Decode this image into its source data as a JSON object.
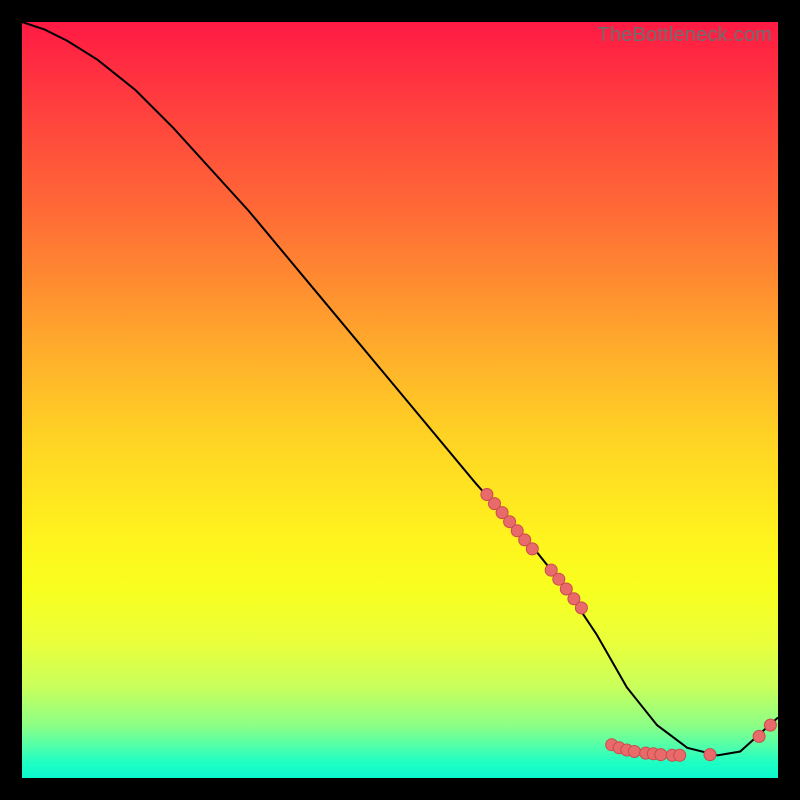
{
  "watermark": "TheBottleneck.com",
  "colors": {
    "curve": "#000000",
    "marker_fill": "#e86a6a",
    "marker_stroke": "#c94b4b"
  },
  "chart_data": {
    "type": "line",
    "title": "",
    "xlabel": "",
    "ylabel": "",
    "xlim": [
      0,
      100
    ],
    "ylim": [
      0,
      100
    ],
    "curve": {
      "x": [
        0,
        3,
        6,
        10,
        15,
        20,
        30,
        40,
        50,
        60,
        68,
        72,
        76,
        80,
        84,
        88,
        92,
        95,
        100
      ],
      "y": [
        100,
        99,
        97.5,
        95,
        91,
        86,
        75,
        63,
        51,
        39,
        30,
        25,
        19,
        12,
        7,
        4,
        3,
        3.5,
        8
      ]
    },
    "series": [
      {
        "name": "marker-cluster-upper",
        "x": [
          61.5,
          62.5,
          63.5,
          64.5,
          65.5,
          66.5,
          67.5,
          70.0,
          71.0,
          72.0,
          73.0,
          74.0
        ],
        "y": [
          37.5,
          36.3,
          35.1,
          33.9,
          32.7,
          31.5,
          30.3,
          27.5,
          26.3,
          25.0,
          23.7,
          22.5
        ]
      },
      {
        "name": "marker-cluster-lower",
        "x": [
          78.0,
          79.0,
          80.0,
          81.0,
          82.5,
          83.5,
          84.5,
          86.0,
          87.0,
          91.0,
          97.5,
          99.0
        ],
        "y": [
          4.4,
          4.0,
          3.7,
          3.5,
          3.3,
          3.2,
          3.1,
          3.0,
          3.0,
          3.1,
          5.5,
          7.0
        ]
      }
    ]
  }
}
